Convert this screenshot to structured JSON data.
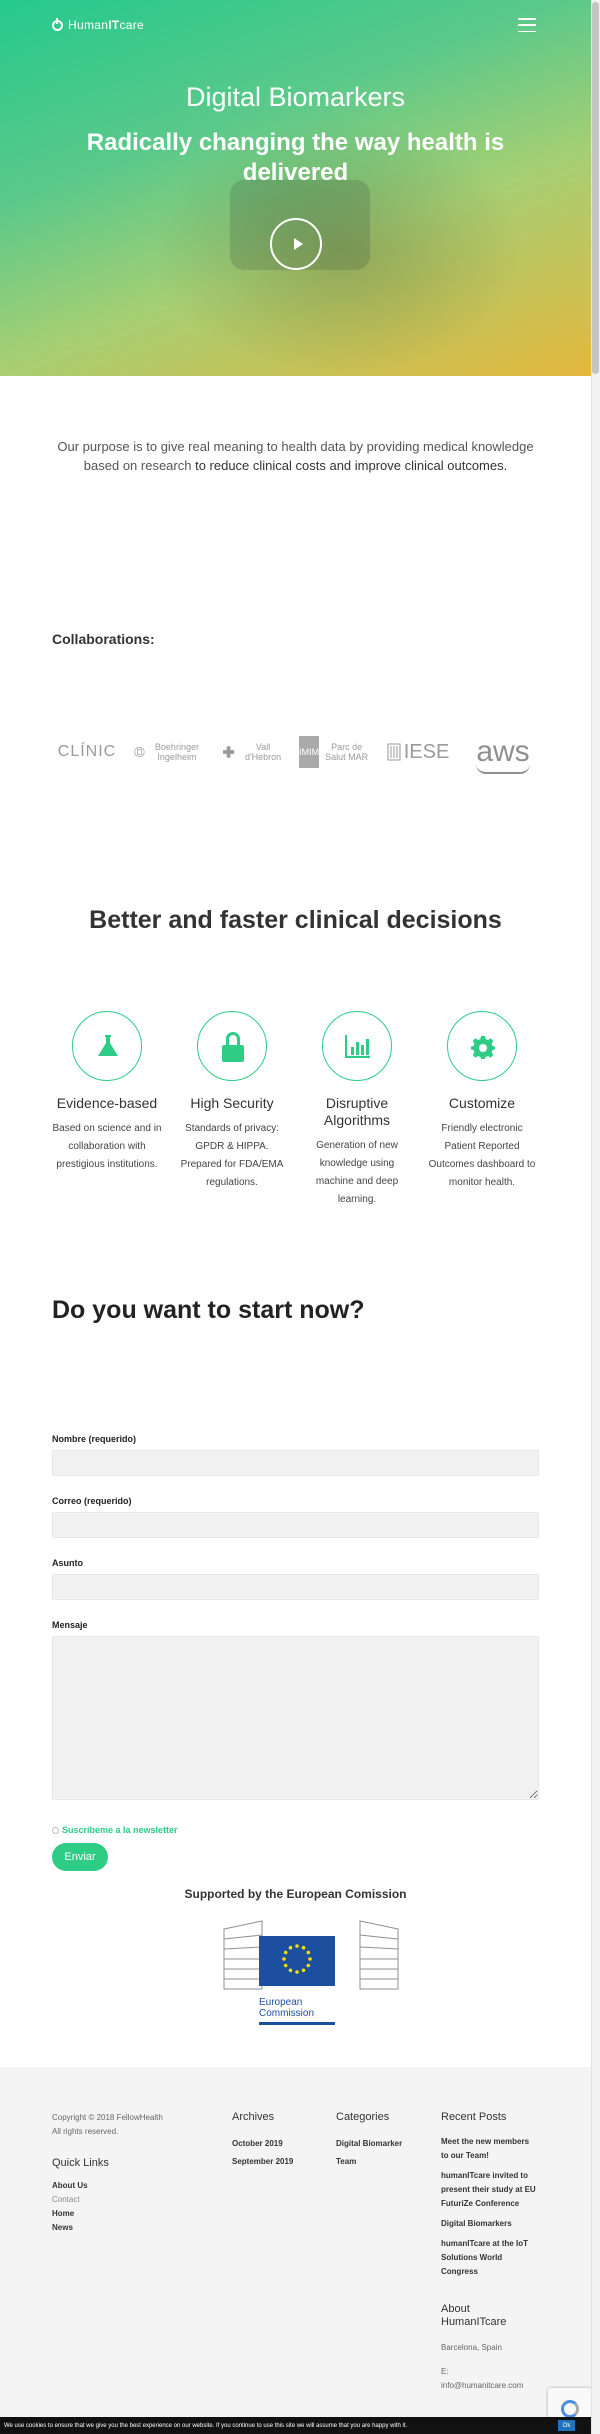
{
  "brand": {
    "name_prefix": "Human",
    "name_bold": "IT",
    "name_suffix": "care"
  },
  "hero": {
    "title": "Digital Biomarkers",
    "subtitle": "Radically changing the way health is delivered"
  },
  "purpose": {
    "text": "Our purpose is to give real meaning to health data by providing medical knowledge based on research ",
    "highlight": "to reduce clinical costs and improve clinical outcomes."
  },
  "collaborations": {
    "title": "Collaborations:",
    "logos": {
      "clinic": "CLÍNIC",
      "boehringer": "Boehringer Ingelheim",
      "vall": "Vall d'Hebron",
      "imim_box": "IMIM",
      "imim": "Parc de Salut MAR",
      "iese": "IESE",
      "aws": "aws"
    }
  },
  "decisions": {
    "title": "Better and faster clinical decisions",
    "features": [
      {
        "icon": "flask-icon",
        "title": "Evidence-based",
        "text": "Based on science and in collaboration with prestigious institutions."
      },
      {
        "icon": "lock-icon",
        "title": "High Security",
        "text": "Standards of privacy: GPDR & HIPPA. Prepared for FDA/EMA regulations."
      },
      {
        "icon": "chart-icon",
        "title": "Disruptive Algorithms",
        "text": "Generation of new knowledge using machine and deep learning."
      },
      {
        "icon": "gear-icon",
        "title": "Customize",
        "text": "Friendly electronic Patient Reported Outcomes dashboard to monitor health."
      }
    ]
  },
  "form": {
    "title": "Do you want to start now?",
    "name_label": "Nombre (requerido)",
    "email_label": "Correo (requerido)",
    "subject_label": "Asunto",
    "message_label": "Mensaje",
    "newsletter_label": "Suscríbeme a la newsletter",
    "submit_label": "Enviar"
  },
  "eu": {
    "title": "Supported by the European Comission",
    "caption_line1": "European",
    "caption_line2": "Commission"
  },
  "footer": {
    "copyright_line1": "Copyright © 2018 FellowHealth",
    "copyright_line2": "All rights reserved.",
    "quick_links_title": "Quick Links",
    "quick_links": [
      "About Us",
      "Contact",
      "Home",
      "News"
    ],
    "archives_title": "Archives",
    "archives": [
      "October 2019",
      "September 2019"
    ],
    "categories_title": "Categories",
    "categories": [
      "Digital Biomarker",
      "Team"
    ],
    "recent_posts_title": "Recent Posts",
    "recent_posts": [
      "Meet the new members to our Team!",
      "humanITcare invited to present their study at EU FuturiZe Conference",
      "Digital Biomarkers",
      "humanITcare at the IoT Solutions World Congress"
    ],
    "about_title": "About HumanITcare",
    "about_location": "Barcelona, Spain",
    "about_email_label": "E:",
    "about_email": "info@humanitcare.com"
  },
  "cookie": {
    "text": "We use cookies to ensure that we give you the best experience on our website. If you continue to use this site we will assume that you are happy with it.",
    "ok_label": "Ok"
  },
  "colors": {
    "accent": "#2ecc85",
    "eu_blue": "#1d4fa0",
    "eu_star": "#ffdd00"
  }
}
